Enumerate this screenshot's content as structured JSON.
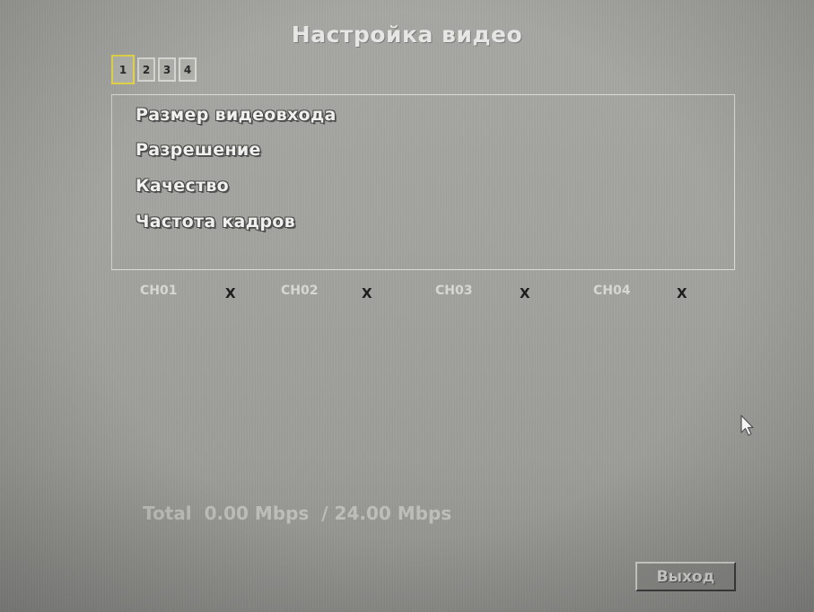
{
  "window": {
    "title": "Настройка видео"
  },
  "tabs": [
    {
      "label": "1",
      "active": true
    },
    {
      "label": "2",
      "active": false
    },
    {
      "label": "3",
      "active": false
    },
    {
      "label": "4",
      "active": false
    }
  ],
  "menu": {
    "items": [
      {
        "label": "Размер видеовхода"
      },
      {
        "label": "Разрешение"
      },
      {
        "label": "Качество"
      },
      {
        "label": "Частота кадров"
      }
    ]
  },
  "channels": [
    {
      "label": "CH01",
      "value": "X"
    },
    {
      "label": "CH02",
      "value": "X"
    },
    {
      "label": "CH03",
      "value": "X"
    },
    {
      "label": "CH04",
      "value": "X"
    }
  ],
  "bandwidth": {
    "label": "Total",
    "used": "0.00 Mbps",
    "separator": "/",
    "max": "24.00 Mbps"
  },
  "buttons": {
    "exit_label": "Выход"
  },
  "icons": {
    "cursor": "mouse-pointer-icon"
  },
  "colors": {
    "active_tab_border": "#e6d84a",
    "background": "#a2a29e"
  }
}
